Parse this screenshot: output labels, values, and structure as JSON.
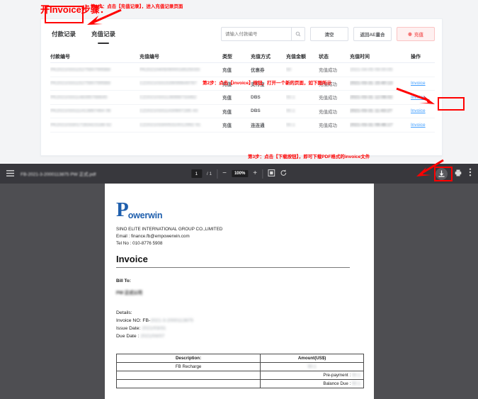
{
  "page": {
    "title": "开Invoice步骤："
  },
  "annotations": {
    "step1": "第1步：点击【充值记录】，进入充值记录页面",
    "step2": "第2步：点击【invoice】按钮，打开一个新的页面，如下图所示",
    "step3": "第3步：点击【下载按钮】，即可下载PDF格式的invoice文件",
    "highlight_color": "#ff0000"
  },
  "app": {
    "tabs": [
      {
        "label": "付款记录",
        "active": false
      },
      {
        "label": "充值记录",
        "active": true
      }
    ],
    "search": {
      "placeholder": "请输入付款编号",
      "value": "",
      "icon": "search-icon"
    },
    "buttons": {
      "clear": "清空",
      "back": "返回AE量合",
      "recharge": "充值",
      "recharge_icon": "coin-icon"
    },
    "table": {
      "columns": [
        "付款编号",
        "充值编号",
        "类型",
        "充值方式",
        "充值金额",
        "状态",
        "充值时间",
        "操作"
      ],
      "rows": [
        {
          "payment_no": "PK2021033115275907995B8",
          "recharge_no": "PK20210405090001652503S",
          "type": "充值",
          "method": "优惠券",
          "amount": "50",
          "status": "充值成功",
          "time": "2021-04-05 09:00:05",
          "action": "",
          "action_visible": false
        },
        {
          "payment_no": "PK2021033115275907995B8",
          "recharge_no": "CZ20210331539099649787",
          "type": "充值",
          "method": "支付宝",
          "amount": "50.1",
          "status": "充值成功",
          "time": "2021-03-31 15:40:13",
          "action": "Invoice",
          "action_visible": true
        },
        {
          "payment_no": "PK20210331148395788645",
          "recharge_no": "CZ20210331136998733462",
          "type": "充值",
          "method": "DBS",
          "amount": "50.1",
          "status": "充值成功",
          "time": "2021-03-31 12:06:02",
          "action": "Invoice",
          "action_visible": true
        },
        {
          "payment_no": "PK2021033111413867464 06",
          "recharge_no": "CZ202103311430697285 43",
          "type": "充值",
          "method": "DBS",
          "amount": "50.1",
          "status": "充值成功",
          "time": "2021-03-31 11:43:27",
          "action": "Invoice",
          "action_visible": true
        },
        {
          "payment_no": "PK2021033017283423188 62",
          "recharge_no": "CZ2021033005310012992 91",
          "type": "充值",
          "method": "连连通",
          "amount": "50.1",
          "status": "充值成功",
          "time": "2021-03-31 09:46:17",
          "action": "Invoice",
          "action_visible": true
        }
      ]
    }
  },
  "pdf_viewer": {
    "menu_icon": "hamburger-icon",
    "filename": "FB-2021-3-2000113875 PW 正式.pdf",
    "page_current": "1",
    "page_total": "/ 1",
    "zoom_out_icon": "minus-icon",
    "zoom_level": "100%",
    "zoom_in_icon": "plus-icon",
    "fit_icon": "fit-page-icon",
    "rotate_icon": "rotate-icon",
    "download_icon": "download-icon",
    "print_icon": "print-icon",
    "more_icon": "more-vertical-icon"
  },
  "invoice": {
    "logo_first": "P",
    "logo_rest": "owerwin",
    "company": "SINO ELITE INTERNATIONAL GROUP CO.,LIMITED",
    "email": "Email : finance.fb@empowerwin.com",
    "tel": "Tel No : 010-8776 5908",
    "heading": "Invoice",
    "bill_to_label": "Bill To:",
    "bill_to_value": "PW 正式公司",
    "details_label": "Details:",
    "invoice_no_label": "Invoice NO: FB-",
    "invoice_no_value": "2021-3-2000113875",
    "issue_date_label": "Issue Date: ",
    "issue_date_value": "2021/03/31",
    "due_date_label": "Due Date : ",
    "due_date_value": "2021/04/07",
    "table": {
      "headers": [
        "Description:",
        "Amount(US$)"
      ],
      "rows": [
        {
          "desc": "FB Recharge",
          "amount": "50.1"
        },
        {
          "desc": "",
          "label": "Pre-payment :",
          "amount": "50.1"
        },
        {
          "desc": "",
          "label": "Balance Due :",
          "amount": "50.1"
        }
      ]
    }
  }
}
